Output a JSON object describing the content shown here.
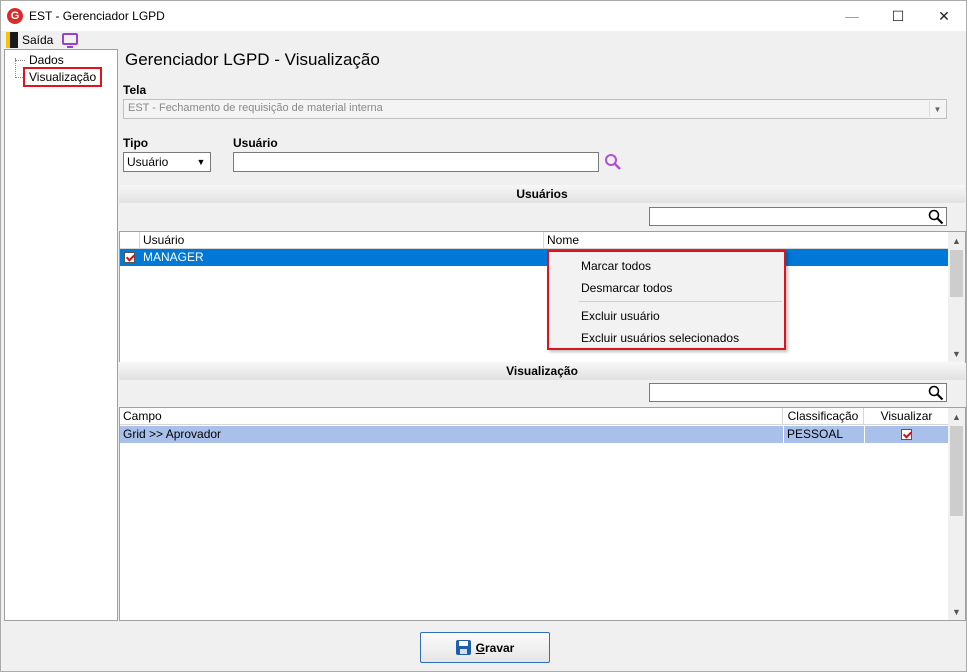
{
  "window": {
    "logo_letter": "G",
    "title": "EST - Gerenciador LGPD",
    "minimize": "—",
    "maximize": "☐",
    "close": "✕"
  },
  "toolbar": {
    "exit_label": "Saída"
  },
  "tree": {
    "items": [
      {
        "label": "Dados"
      },
      {
        "label": "Visualização",
        "selected": true
      }
    ]
  },
  "main": {
    "title": "Gerenciador LGPD - Visualização",
    "tela_label": "Tela",
    "tela_value": "EST - Fechamento de requisição de material interna",
    "tipo_label": "Tipo",
    "tipo_value": "Usuário",
    "usuario_label": "Usuário",
    "usuario_value": ""
  },
  "users_section": {
    "title": "Usuários",
    "filter_value": "",
    "columns": [
      "Usuário",
      "Nome"
    ],
    "rows": [
      {
        "checked": true,
        "usuario": "MANAGER",
        "nome": ""
      }
    ]
  },
  "context_menu": {
    "items": [
      "Marcar todos",
      "Desmarcar todos",
      "Excluir usuário",
      "Excluir usuários selecionados"
    ]
  },
  "visual_section": {
    "title": "Visualização",
    "filter_value": "",
    "columns": [
      "Campo",
      "Classificação",
      "Visualizar"
    ],
    "rows": [
      {
        "campo": "Grid >> Aprovador",
        "classificacao": "PESSOAL",
        "visualizar": true
      }
    ]
  },
  "footer": {
    "save_label_first": "G",
    "save_label_rest": "ravar"
  },
  "colors": {
    "selection_blue": "#0078d7",
    "row_highlight": "#a9c1ea",
    "accent_red": "#d8141c",
    "icon_purple": "#9b3fcf"
  }
}
